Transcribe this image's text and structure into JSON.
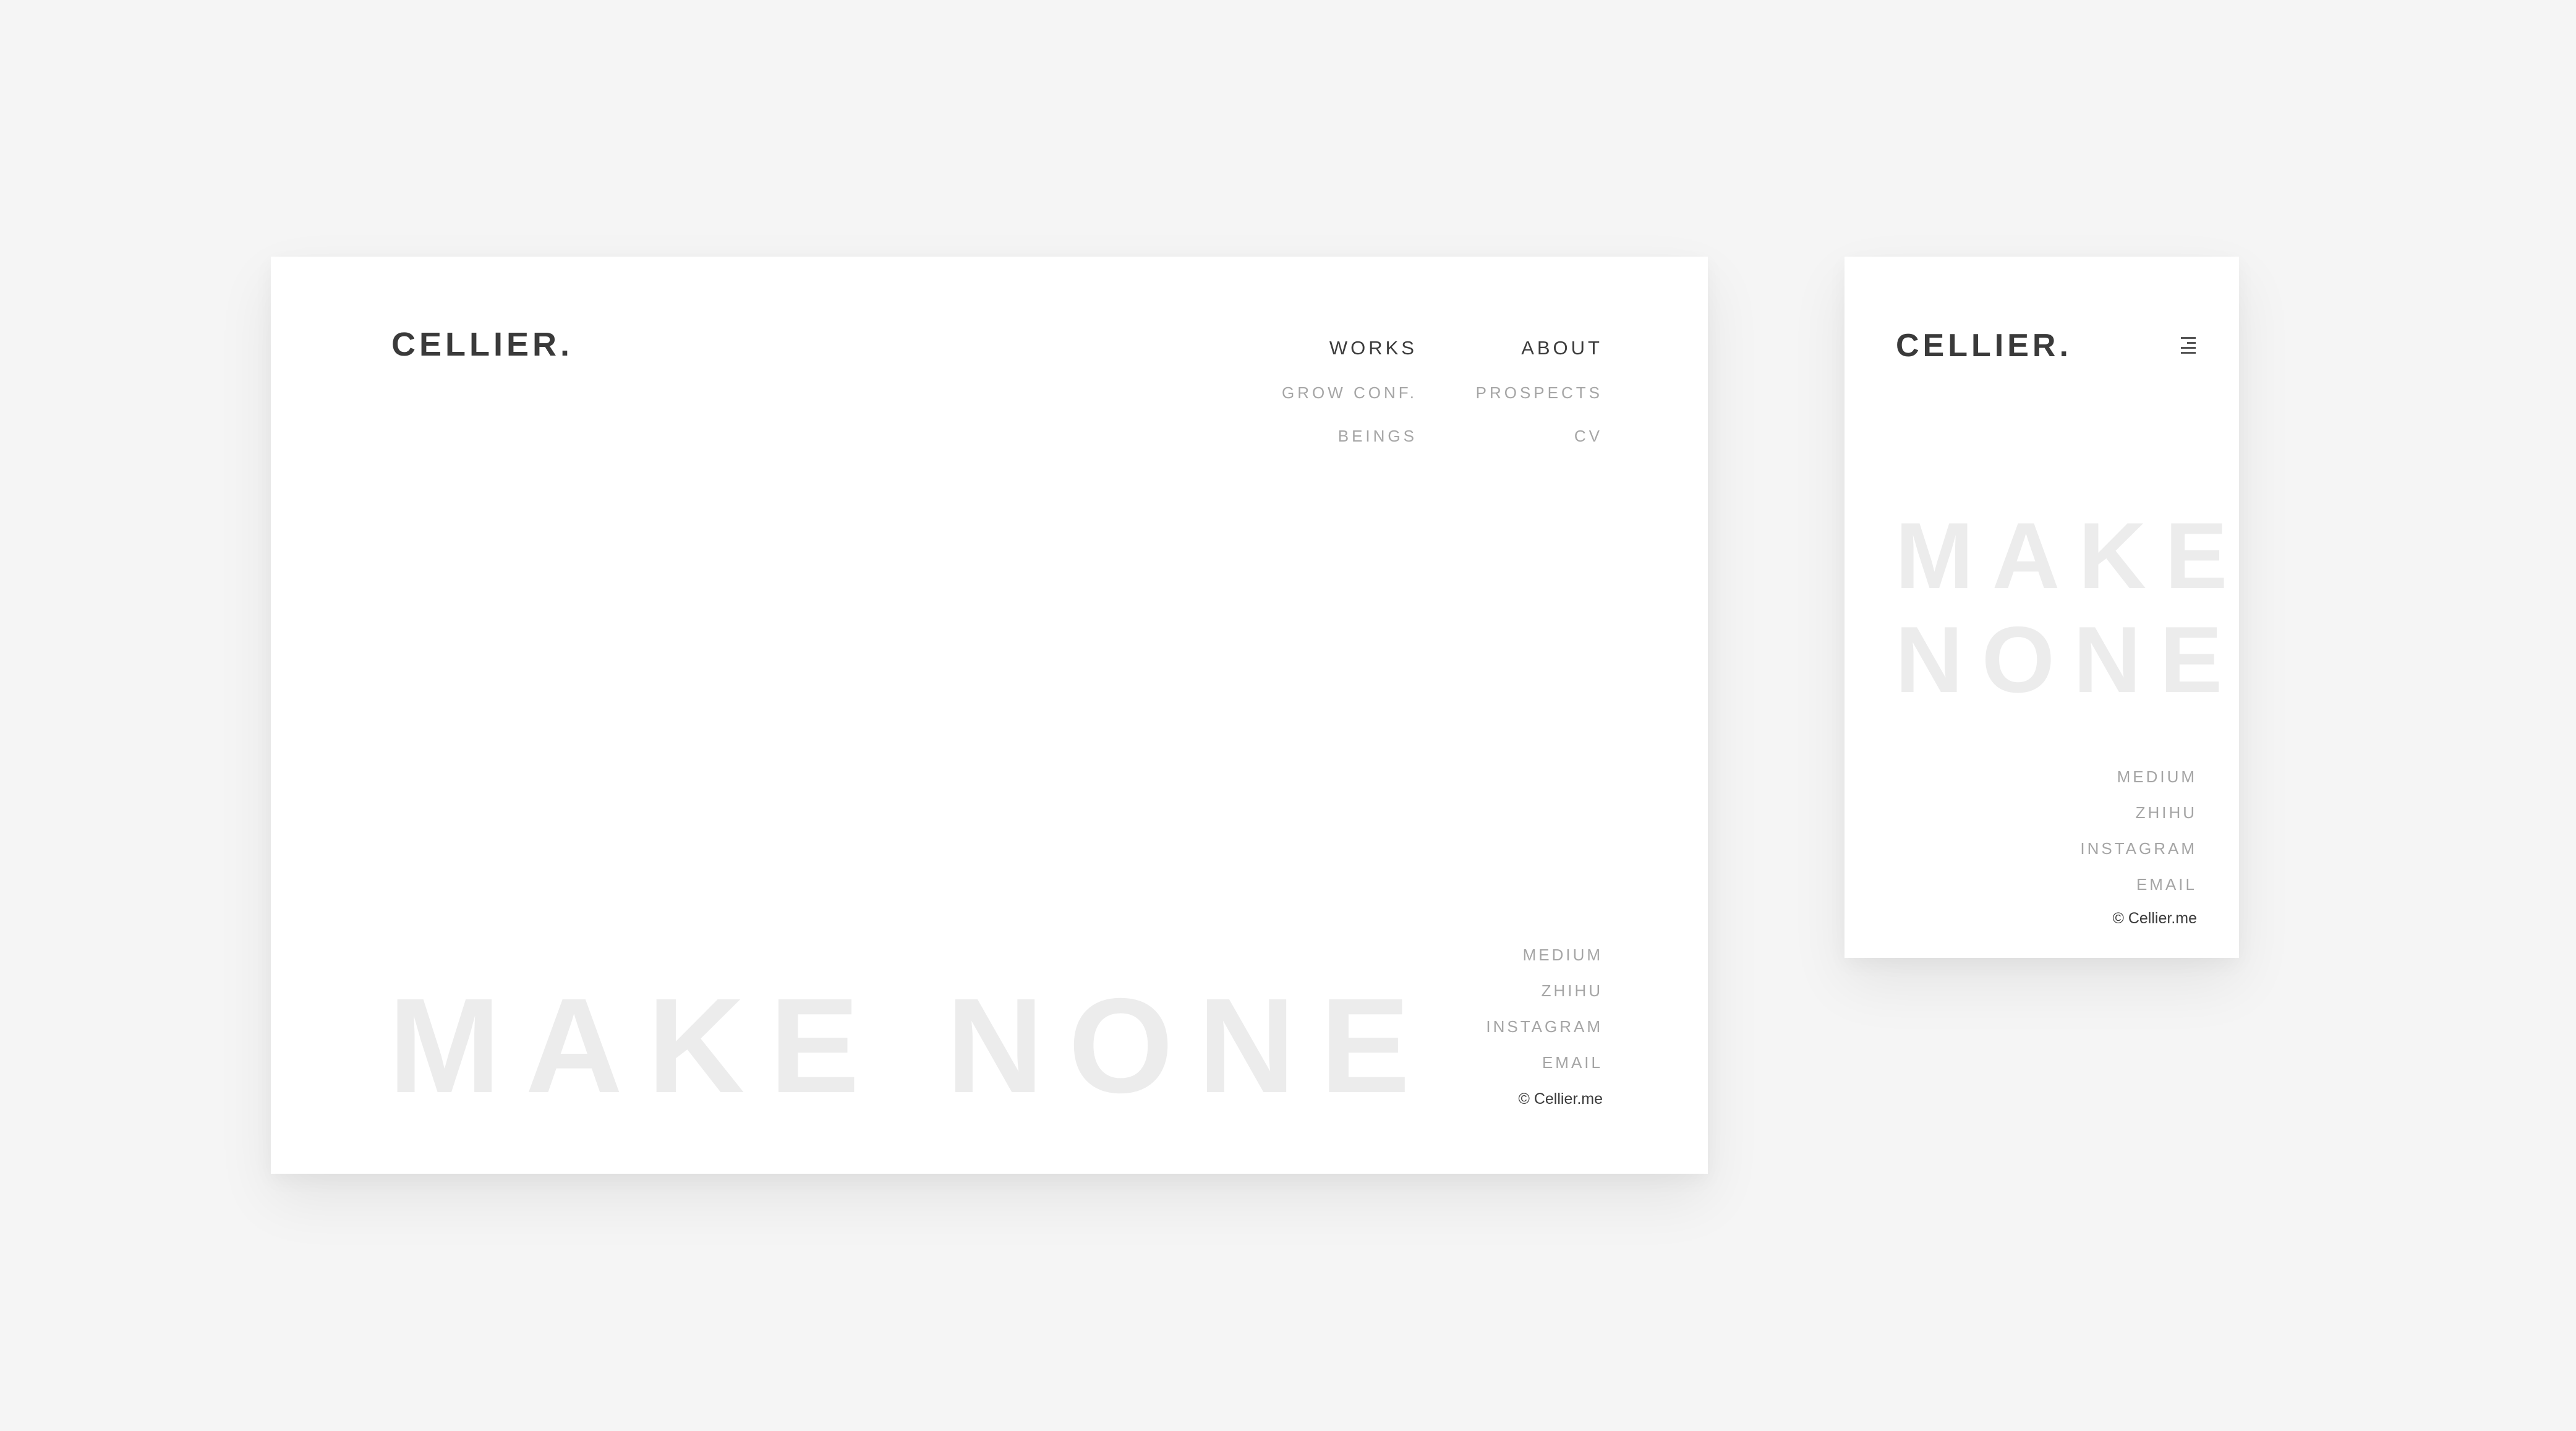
{
  "desktop": {
    "logo": "CELLIER.",
    "nav": {
      "works": {
        "label": "WORKS",
        "items": [
          "GROW CONF.",
          "BEINGS"
        ]
      },
      "about": {
        "label": "ABOUT",
        "items": [
          "PROSPECTS",
          "CV"
        ]
      }
    },
    "hero": "MAKE NONE",
    "social": [
      "MEDIUM",
      "ZHIHU",
      "INSTAGRAM",
      "EMAIL"
    ],
    "copyright": "© Cellier.me"
  },
  "mobile": {
    "logo": "CELLIER.",
    "menu_icon": "hamburger-menu-icon",
    "hero_line1": "MAKE",
    "hero_line2": "NONE",
    "social": [
      "MEDIUM",
      "ZHIHU",
      "INSTAGRAM",
      "EMAIL"
    ],
    "copyright": "© Cellier.me"
  },
  "colors": {
    "background": "#f5f5f5",
    "card": "#ffffff",
    "primary_text": "#3a3a3a",
    "muted_text": "#a5a5a5",
    "hero_text": "#ececec"
  }
}
